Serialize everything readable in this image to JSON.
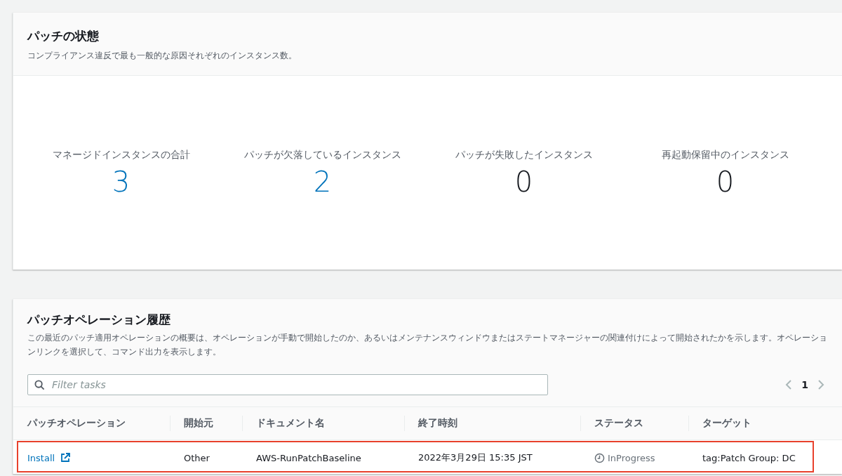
{
  "patch_status": {
    "title": "パッチの状態",
    "description": "コンプライアンス違反で最も一般的な原因それぞれのインスタンス数。",
    "stats": [
      {
        "label": "マネージドインスタンスの合計",
        "value": "3",
        "link": true
      },
      {
        "label": "パッチが欠落しているインスタンス",
        "value": "2",
        "link": true
      },
      {
        "label": "パッチが失敗したインスタンス",
        "value": "0",
        "link": false
      },
      {
        "label": "再起動保留中のインスタンス",
        "value": "0",
        "link": false
      }
    ]
  },
  "history": {
    "title": "パッチオペレーション履歴",
    "description": "この最近のパッチ適用オペレーションの概要は、オペレーションが手動で開始したのか、あるいはメンテナンスウィンドウまたはステートマネージャーの関連付けによって開始されたかを示します。オペレーションリンクを選択して、コマンド出力を表示します。",
    "filter": {
      "placeholder": "Filter tasks"
    },
    "pagination": {
      "page": "1",
      "prev_disabled": true,
      "next_disabled": true
    },
    "columns": [
      "パッチオペレーション",
      "開始元",
      "ドキュメント名",
      "終了時刻",
      "ステータス",
      "ターゲット"
    ],
    "rows": [
      {
        "operation": "Install",
        "initiated_by": "Other",
        "document": "AWS-RunPatchBaseline",
        "end_time": "2022年3月29日 15:35 JST",
        "status": "InProgress",
        "target": "tag:Patch Group: DC",
        "highlighted": true
      }
    ]
  }
}
